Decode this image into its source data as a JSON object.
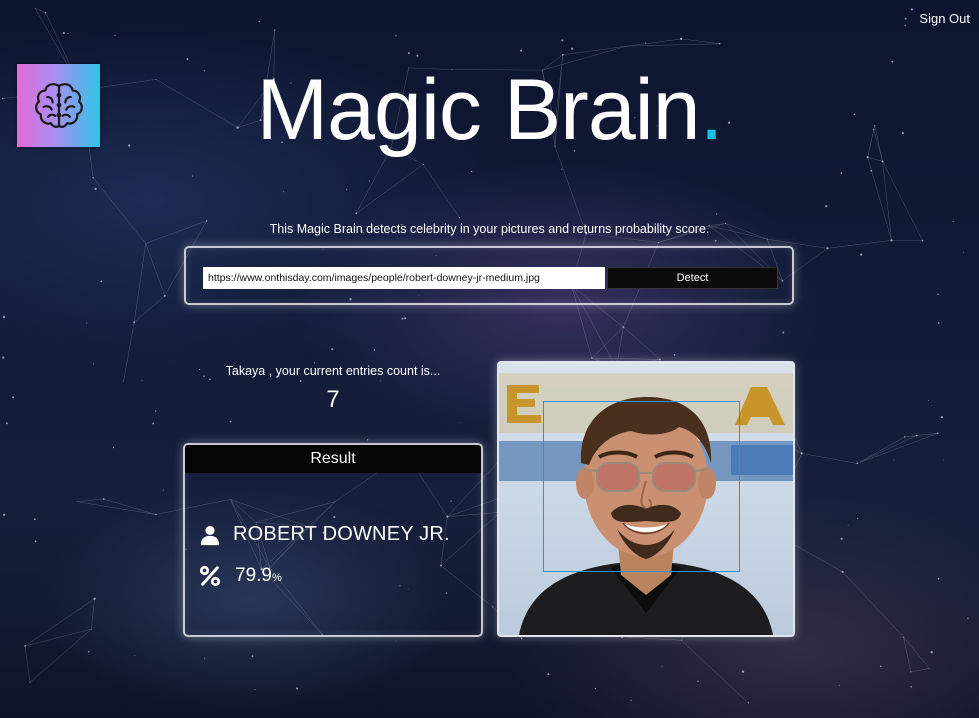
{
  "header": {
    "sign_out_label": "Sign Out"
  },
  "logo": {
    "icon": "brain-icon"
  },
  "title": {
    "text": "Magic Brain",
    "dot": ".",
    "dot_color": "#19c3e6"
  },
  "description": "This Magic Brain detects celebrity in your pictures and returns probability score.",
  "form": {
    "url_value": "https://www.onthisday.com/images/people/robert-downey-jr-medium.jpg",
    "detect_label": "Detect"
  },
  "entries": {
    "text": "Takaya , your current entries count is...",
    "count": "7"
  },
  "result": {
    "header": "Result",
    "name": "ROBERT DOWNEY JR.",
    "name_icon": "user-icon",
    "probability_value": "79.9",
    "probability_unit": "%",
    "probability_icon": "percent-icon"
  },
  "photo": {
    "face_box_color": "#2f8fe0"
  }
}
